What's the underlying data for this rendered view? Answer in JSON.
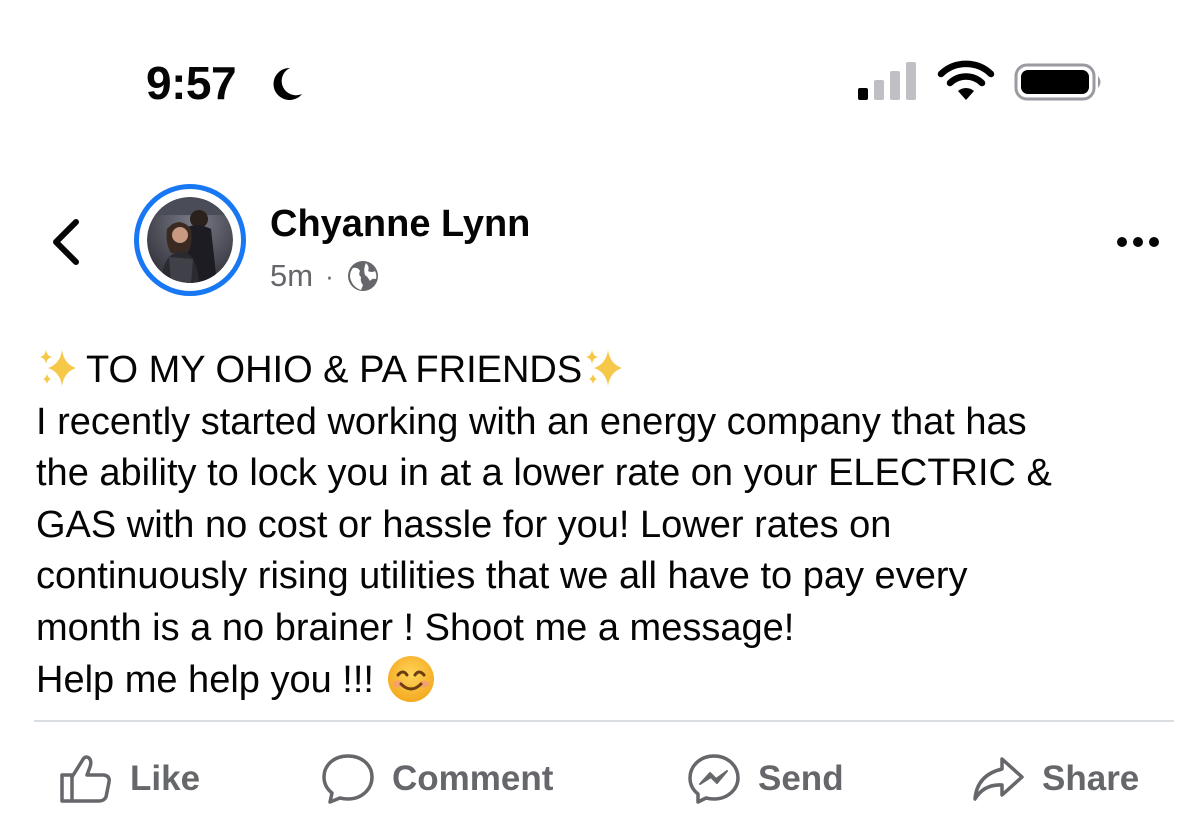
{
  "status_bar": {
    "time": "9:57",
    "icons": [
      "moon-icon",
      "signal-icon",
      "wifi-icon",
      "battery-icon"
    ]
  },
  "post": {
    "author": "Chyanne Lynn",
    "timestamp": "5m",
    "separator": "·",
    "privacy_icon": "globe-icon",
    "avatar_ring_color": "#1877f2",
    "headline": "TO MY OHIO & PA FRIENDS",
    "body_lines": [
      "I recently started working with an energy company that has",
      "the ability to lock you in at a lower rate on your ELECTRIC &",
      "GAS with no cost or hassle for you! Lower rates on",
      "continuously rising utilities that we all have to pay every",
      "month is a no brainer ! Shoot me a message!",
      "Help me help you !!!"
    ],
    "emoji_icons": [
      "sparkles-icon",
      "smiling-face-icon"
    ]
  },
  "actions": {
    "like": "Like",
    "comment": "Comment",
    "send": "Send",
    "share": "Share"
  },
  "colors": {
    "text_primary": "#050505",
    "text_secondary": "#65676b",
    "accent": "#1877f2",
    "divider": "#dadde1"
  }
}
